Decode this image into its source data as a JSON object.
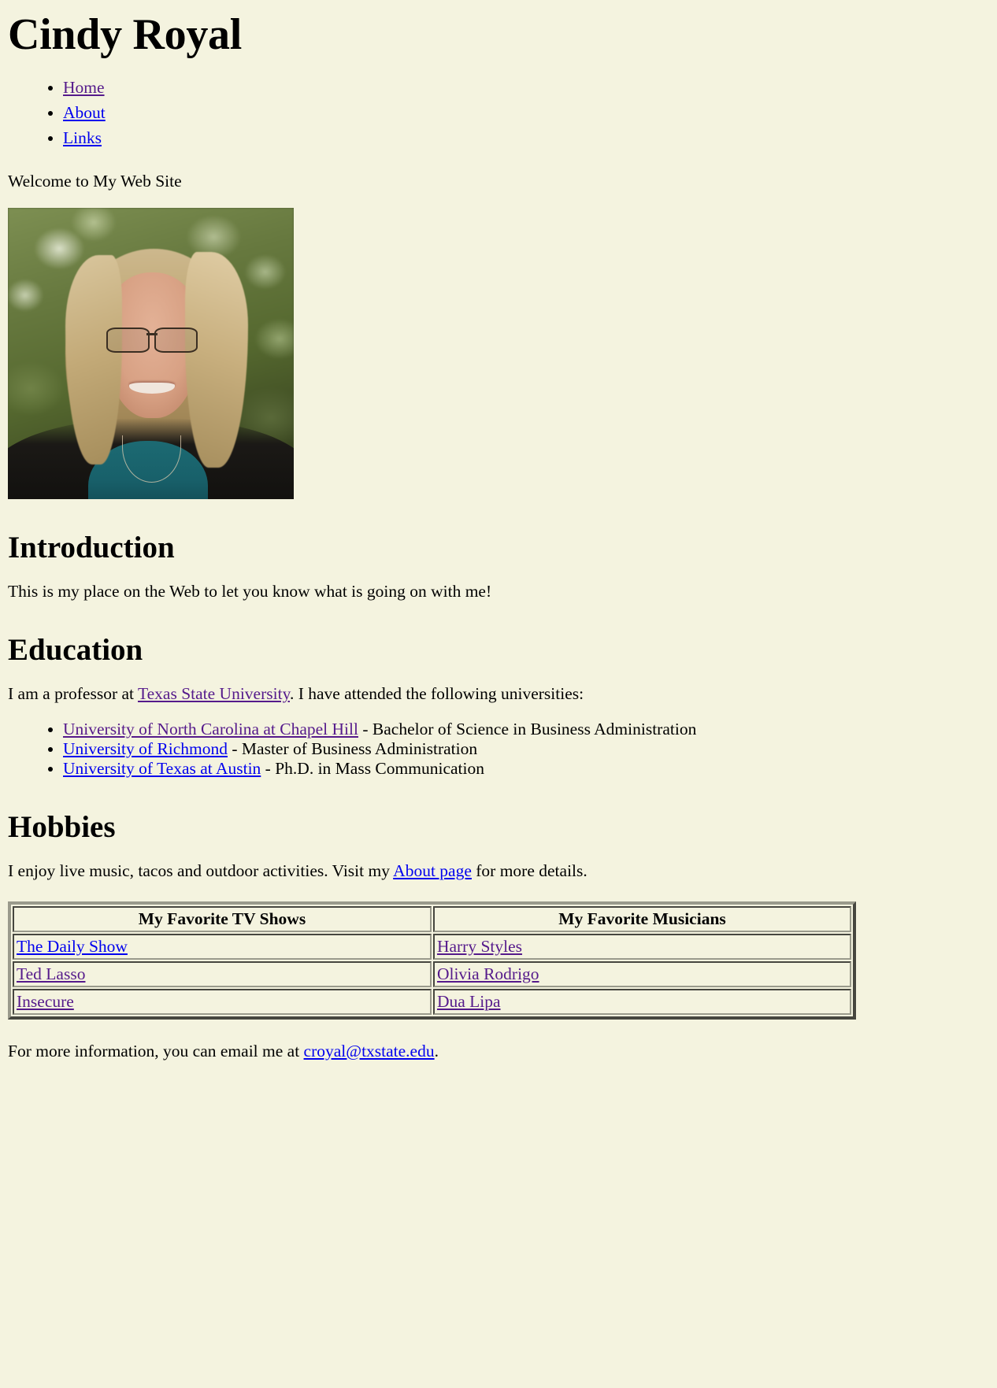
{
  "site": {
    "title": "Cindy Royal",
    "background_color": "#f4f3df",
    "link_color": "#0000ee",
    "visited_link_color": "#551a8b"
  },
  "nav": {
    "items": [
      {
        "label": "Home",
        "state": "visited"
      },
      {
        "label": "About",
        "state": "unvisited"
      },
      {
        "label": "Links",
        "state": "unvisited"
      }
    ]
  },
  "welcome": {
    "text": "Welcome to My Web Site"
  },
  "photo": {
    "alt": "Portrait photo of Cindy Royal outdoors with green foliage background"
  },
  "introduction": {
    "heading": "Introduction",
    "body": "This is my place on the Web to let you know what is going on with me!"
  },
  "education": {
    "heading": "Education",
    "intro_before": "I am a professor at ",
    "intro_link": "Texas State University",
    "intro_link_state": "visited",
    "intro_after": ". I have attended the following universities:",
    "schools": [
      {
        "link": "University of North Carolina at Chapel Hill",
        "state": "visited",
        "degree": " - Bachelor of Science in Business Administration"
      },
      {
        "link": "University of Richmond",
        "state": "unvisited",
        "degree": " - Master of Business Administration"
      },
      {
        "link": "University of Texas at Austin",
        "state": "unvisited",
        "degree": " - Ph.D. in Mass Communication"
      }
    ]
  },
  "hobbies": {
    "heading": "Hobbies",
    "body_before": "I enjoy live music, tacos and outdoor activities. Visit my ",
    "body_link": "About page",
    "body_link_state": "unvisited",
    "body_after": " for more details."
  },
  "favorites_table": {
    "headers": [
      "My Favorite TV Shows",
      "My Favorite Musicians"
    ],
    "rows": [
      [
        {
          "label": "The Daily Show",
          "state": "unvisited"
        },
        {
          "label": "Harry Styles",
          "state": "visited"
        }
      ],
      [
        {
          "label": "Ted Lasso",
          "state": "visited"
        },
        {
          "label": "Olivia Rodrigo",
          "state": "visited"
        }
      ],
      [
        {
          "label": "Insecure",
          "state": "visited"
        },
        {
          "label": "Dua Lipa",
          "state": "visited"
        }
      ]
    ]
  },
  "contact": {
    "before": "For more information, you can email me at ",
    "email": "croyal@txstate.edu",
    "email_state": "unvisited",
    "after": "."
  }
}
